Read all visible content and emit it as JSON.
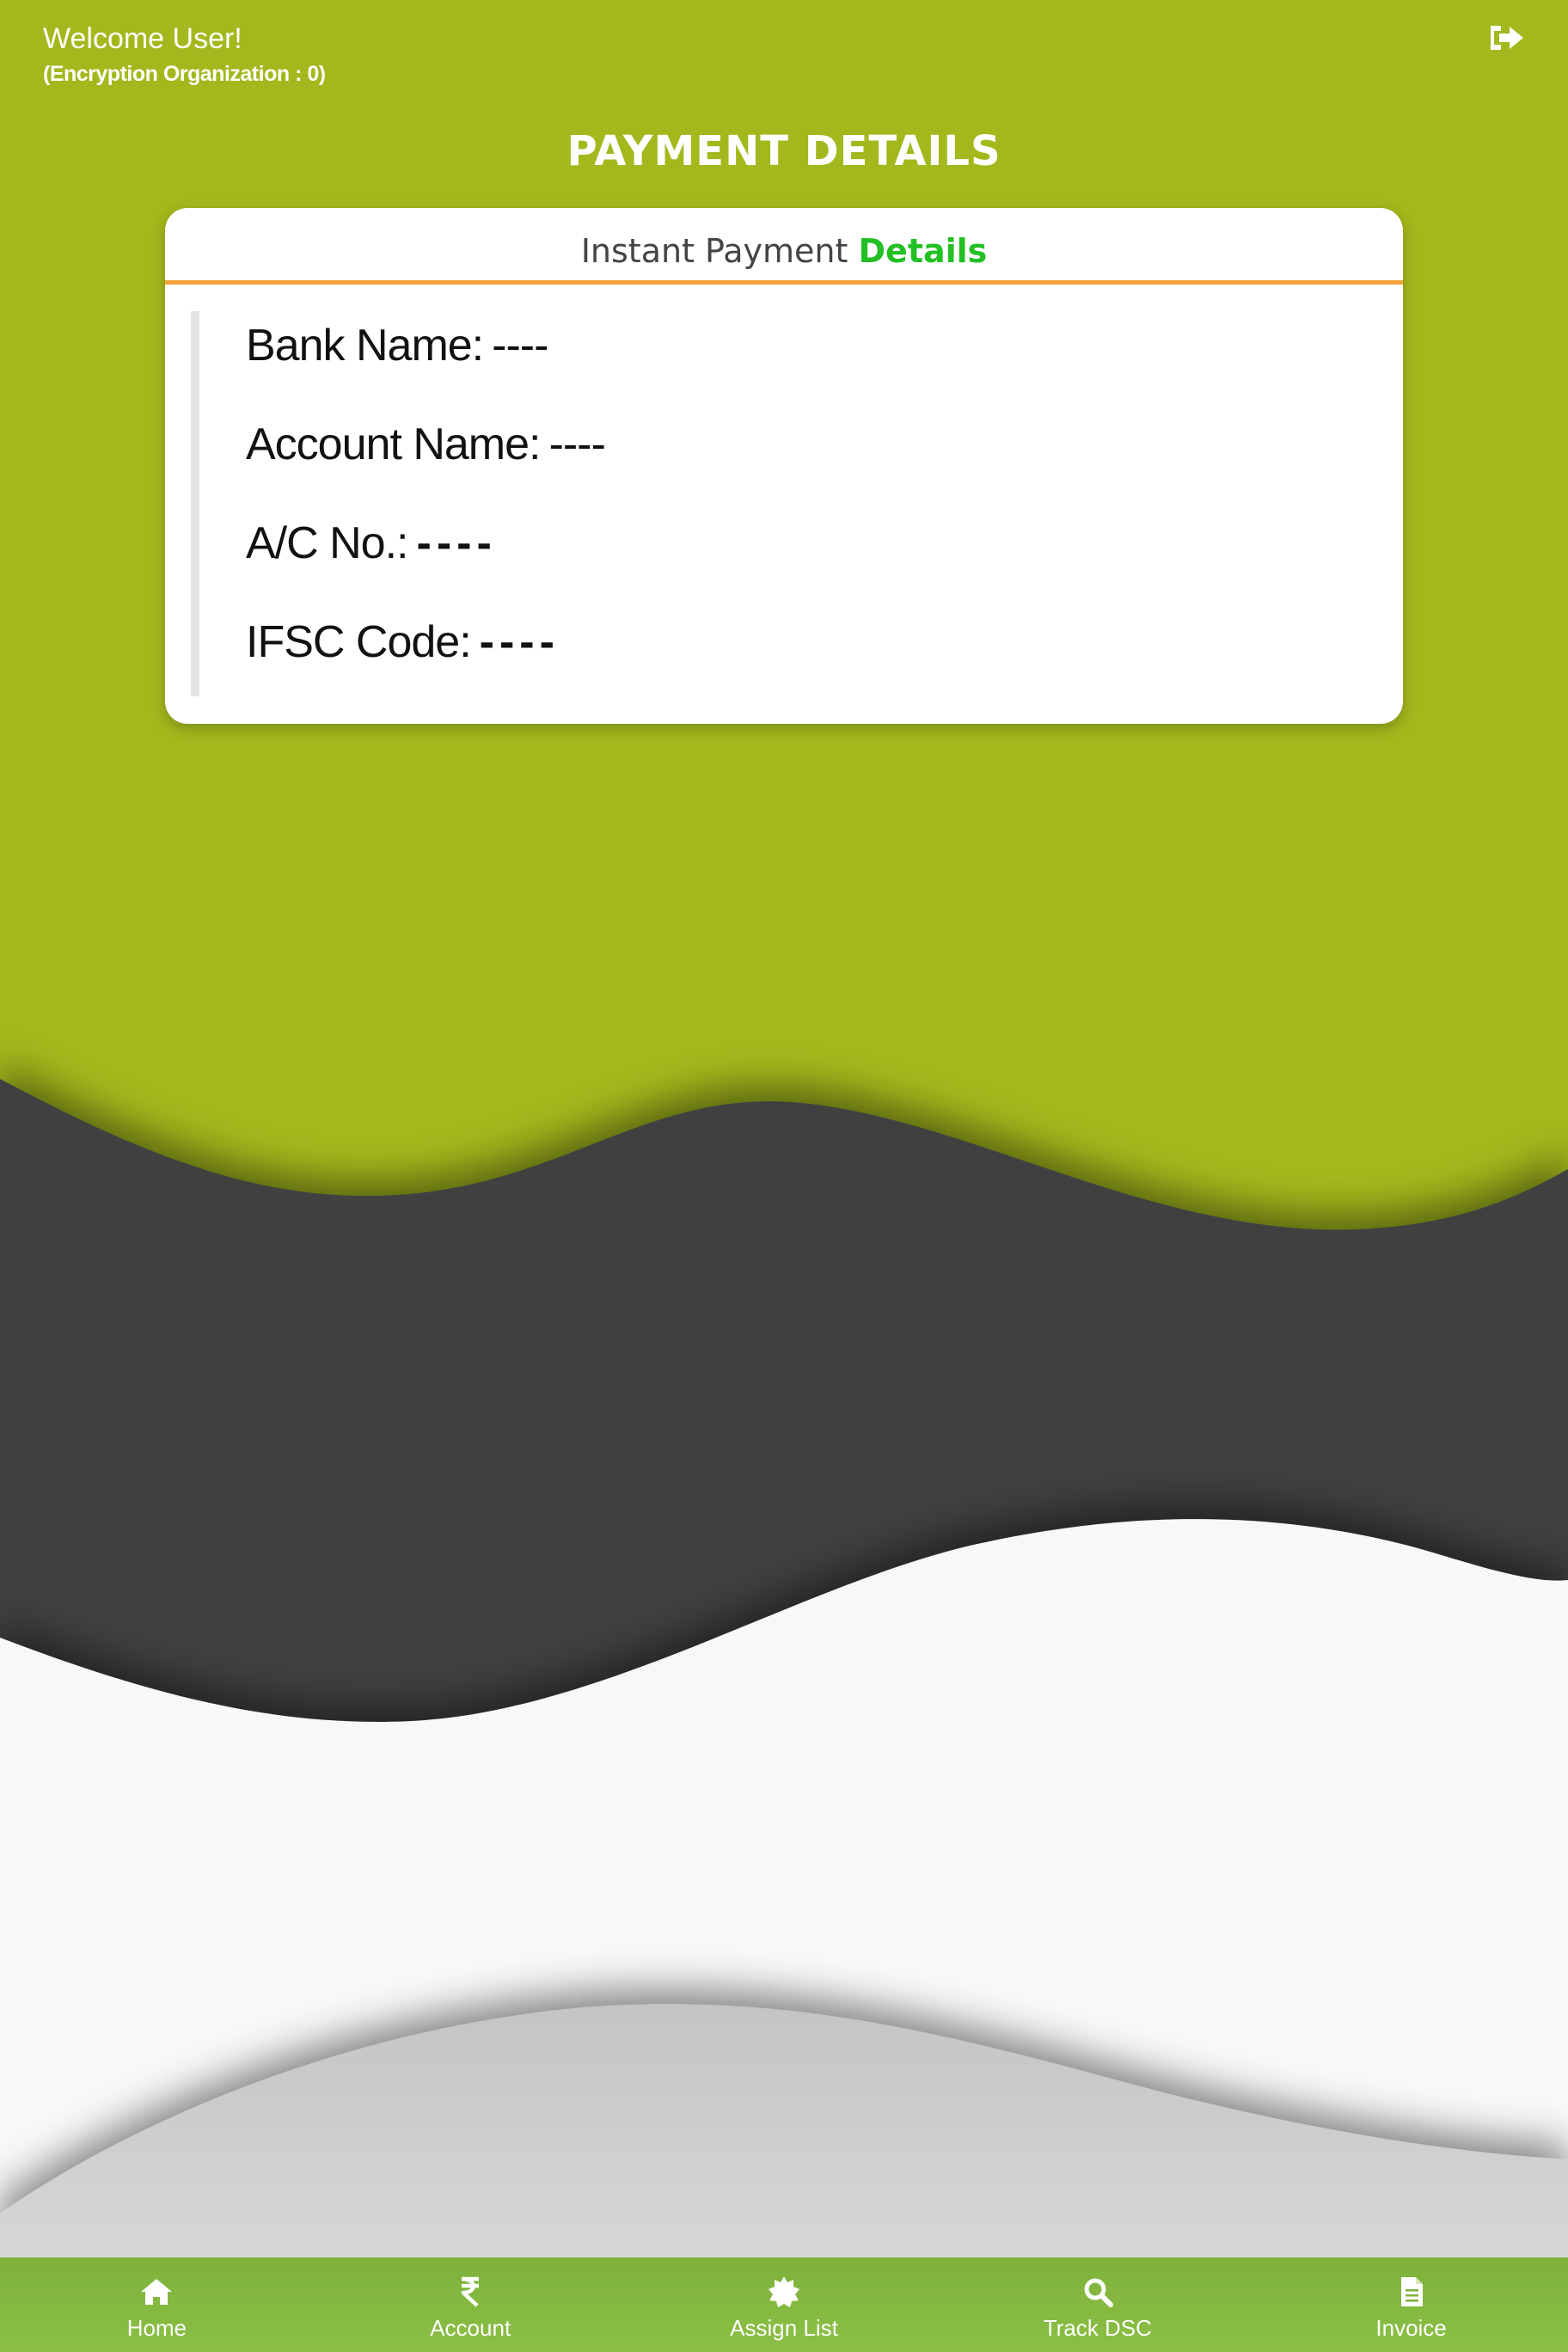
{
  "header": {
    "welcome": "Welcome User!",
    "organization": "(Encryption Organization : 0)",
    "logout_icon": "sign-out-icon"
  },
  "page": {
    "title": "PAYMENT DETAILS"
  },
  "card": {
    "title_prefix": "Instant Payment",
    "title_accent": "Details",
    "rows": [
      {
        "label": "Bank Name:",
        "value": "----"
      },
      {
        "label": "Account Name:",
        "value": "----"
      },
      {
        "label": "A/C No.:",
        "value": "----"
      },
      {
        "label": "IFSC Code:",
        "value": "----"
      }
    ]
  },
  "nav": {
    "items": [
      {
        "label": "Home",
        "icon": "home-icon"
      },
      {
        "label": "Account",
        "icon": "rupee-icon"
      },
      {
        "label": "Assign List",
        "icon": "certificate-icon"
      },
      {
        "label": "Track DSC",
        "icon": "search-icon"
      },
      {
        "label": "Invoice",
        "icon": "document-icon"
      }
    ]
  },
  "colors": {
    "primary": "#a3b81c",
    "dark_wave": "#3f3f3f",
    "light_wave": "#f8f8f8",
    "divider": "#f4a23a",
    "accent_text": "#22c024",
    "nav_bar": "#83b841"
  }
}
